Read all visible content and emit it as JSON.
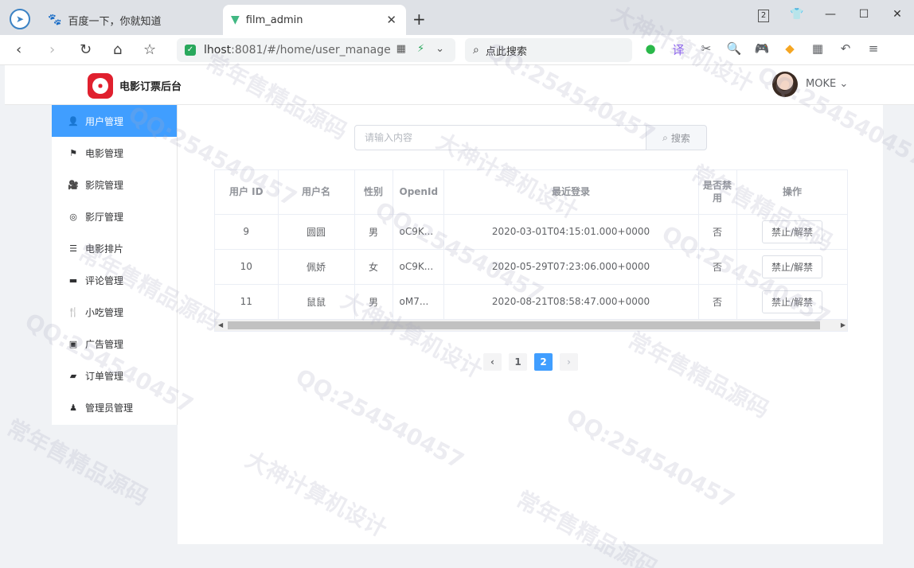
{
  "browser": {
    "tabs": [
      {
        "title": "百度一下，你就知道",
        "active": false
      },
      {
        "title": "film_admin",
        "active": true
      }
    ],
    "address": {
      "host": "lhost",
      "rest": ":8081/#/home/user_manage"
    },
    "search_placeholder": "点此搜索",
    "tab_count": "2"
  },
  "header": {
    "app_title": "电影订票后台",
    "user_name": "MOKE"
  },
  "sidebar": {
    "items": [
      {
        "label": "用户管理",
        "icon": "user-icon",
        "active": true
      },
      {
        "label": "电影管理",
        "icon": "flag-icon",
        "active": false
      },
      {
        "label": "影院管理",
        "icon": "camera-icon",
        "active": false
      },
      {
        "label": "影厅管理",
        "icon": "circle-icon",
        "active": false
      },
      {
        "label": "电影排片",
        "icon": "list-icon",
        "active": false
      },
      {
        "label": "评论管理",
        "icon": "comment-icon",
        "active": false
      },
      {
        "label": "小吃管理",
        "icon": "fork-icon",
        "active": false
      },
      {
        "label": "广告管理",
        "icon": "picture-icon",
        "active": false
      },
      {
        "label": "订单管理",
        "icon": "ticket-icon",
        "active": false
      },
      {
        "label": "管理员管理",
        "icon": "admin-icon",
        "active": false
      }
    ]
  },
  "filter": {
    "placeholder": "请输入内容",
    "search_label": "搜索"
  },
  "table": {
    "columns": [
      "用户 ID",
      "用户名",
      "性别",
      "OpenId",
      "最近登录",
      "是否禁用",
      "操作"
    ],
    "rows": [
      {
        "id": "9",
        "name": "圆圆",
        "gender": "男",
        "openid": "oC9K...",
        "last_login": "2020-03-01T04:15:01.000+0000",
        "banned": "否",
        "action": "禁止/解禁"
      },
      {
        "id": "10",
        "name": "佩娇",
        "gender": "女",
        "openid": "oC9K...",
        "last_login": "2020-05-29T07:23:06.000+0000",
        "banned": "否",
        "action": "禁止/解禁"
      },
      {
        "id": "11",
        "name": "鼠鼠",
        "gender": "男",
        "openid": "oM7...",
        "last_login": "2020-08-21T08:58:47.000+0000",
        "banned": "否",
        "action": "禁止/解禁"
      }
    ]
  },
  "pagination": {
    "pages": [
      "1",
      "2"
    ],
    "current": "2"
  },
  "watermarks": [
    "QQ:254540457",
    "常年售精品源码",
    "大神计算机设计"
  ],
  "colors": {
    "primary": "#409eff",
    "logo_red": "#e0202e"
  }
}
